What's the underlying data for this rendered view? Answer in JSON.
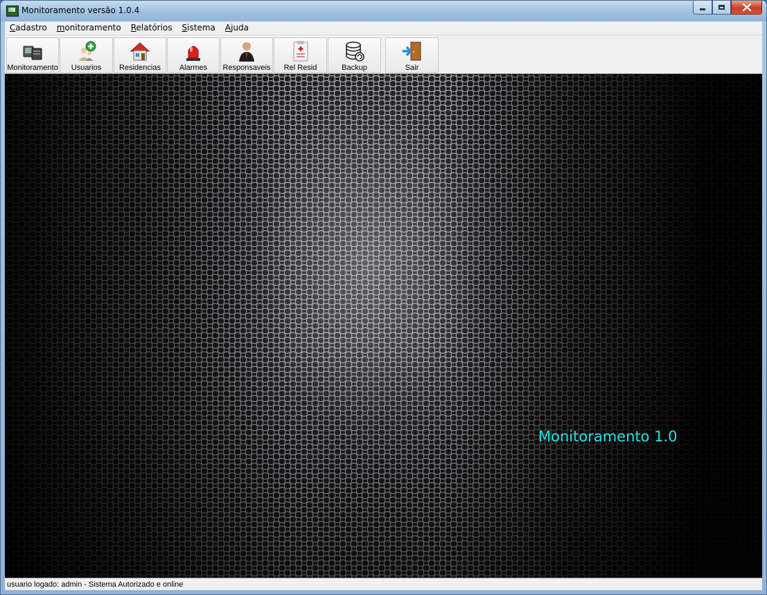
{
  "window": {
    "title": "Monitoramento versão 1.0.4"
  },
  "menu": {
    "items": [
      {
        "label": "Cadastro",
        "mnemonic": "C"
      },
      {
        "label": "monitoramento",
        "mnemonic": "m"
      },
      {
        "label": "Relatórios",
        "mnemonic": "R"
      },
      {
        "label": "Sistema",
        "mnemonic": "S"
      },
      {
        "label": "Ajuda",
        "mnemonic": "A"
      }
    ]
  },
  "toolbar": {
    "buttons": [
      {
        "label": "Monitoramento",
        "icon": "computer-icon"
      },
      {
        "label": "Usuarios",
        "icon": "add-user-icon"
      },
      {
        "label": "Residencias",
        "icon": "house-icon"
      },
      {
        "label": "Alarmes",
        "icon": "alarm-siren-icon"
      },
      {
        "label": "Responsaveis",
        "icon": "person-suit-icon"
      },
      {
        "label": "Rel Resid",
        "icon": "report-clipboard-icon"
      },
      {
        "label": "Backup",
        "icon": "database-backup-icon"
      },
      {
        "label": "Sair",
        "icon": "exit-door-icon"
      }
    ]
  },
  "main": {
    "brand_text": "Monitoramento 1.0",
    "brand_color": "#1ee6e6"
  },
  "status": {
    "text": "usuario logado: admin - Sistema Autorizado e online"
  }
}
